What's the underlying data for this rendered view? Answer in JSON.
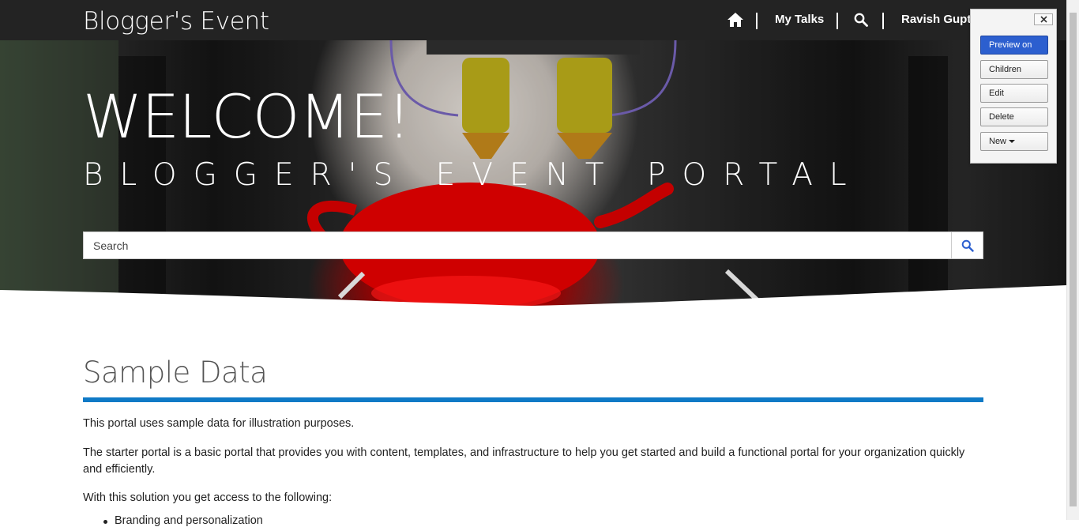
{
  "navbar": {
    "brand": "Blogger's Event",
    "home_icon": "home-icon",
    "my_talks": "My Talks",
    "search_icon": "search-icon",
    "user": "Ravish Gupta"
  },
  "hero": {
    "welcome": "WELCOME!",
    "subtitle": "BLOGGER'S EVENT PORTAL",
    "search_placeholder": "Search",
    "search_button_icon": "search-icon"
  },
  "content": {
    "title": "Sample Data",
    "paragraph1": "This portal uses sample data for illustration purposes.",
    "paragraph2": "The starter portal is a basic portal that provides you with content, templates, and infrastructure to help you get started and build a functional portal for your organization quickly and efficiently.",
    "paragraph3": "With this solution you get access to the following:",
    "bullet1": "Branding and personalization"
  },
  "admin_panel": {
    "close_icon": "close-icon",
    "buttons": {
      "preview": "Preview on",
      "children": "Children",
      "edit": "Edit",
      "delete": "Delete",
      "new": "New"
    }
  },
  "colors": {
    "navbar": "#232323",
    "accent_rule": "#0f7ac6",
    "primary_button": "#2c5fcf"
  }
}
